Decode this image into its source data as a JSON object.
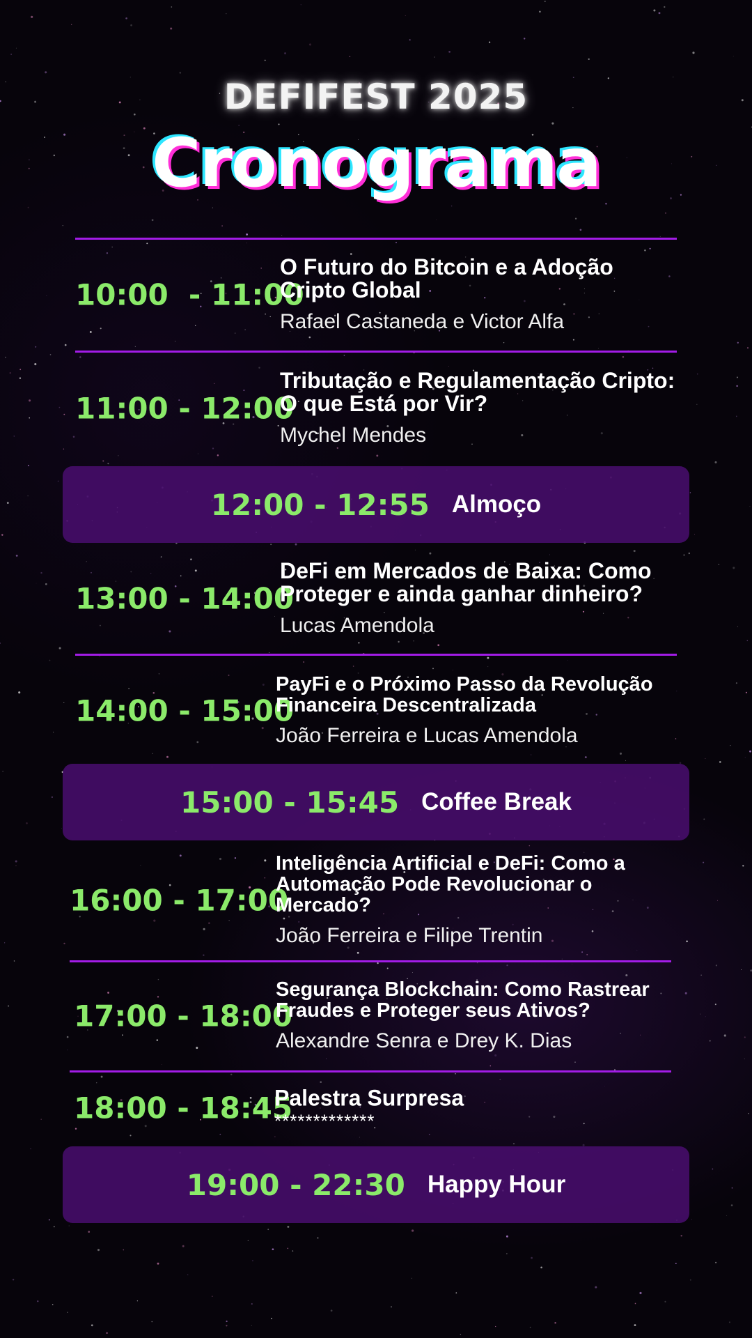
{
  "header": {
    "event_name": "DEFIFEST 2025",
    "title": "Cronograma"
  },
  "colors": {
    "background": "#07040b",
    "accent_purple": "#a21ce6",
    "break_bar": "#480e6c",
    "time_green": "#8bea6a",
    "text": "#ffffff"
  },
  "schedule": [
    {
      "time": "10:00  - 11:00",
      "title": "O Futuro do Bitcoin e a Adoção Cripto Global",
      "speaker": "Rafael Castaneda e Victor Alfa"
    },
    {
      "time": "11:00 - 12:00",
      "title": "Tributação e Regulamentação Cripto: O que Está por Vir?",
      "speaker": "Mychel Mendes"
    },
    {
      "time": "12:00 - 12:55",
      "label": "Almoço"
    },
    {
      "time": "13:00 - 14:00",
      "title": "DeFi em Mercados de Baixa: Como Proteger e ainda ganhar dinheiro?",
      "speaker": "Lucas Amendola"
    },
    {
      "time": "14:00 - 15:00",
      "title": "PayFi e o Próximo Passo da Revolução Financeira Descentralizada",
      "speaker": "João Ferreira e Lucas Amendola"
    },
    {
      "time": "15:00 - 15:45",
      "label": "Coffee Break"
    },
    {
      "time": "16:00 - 17:00",
      "title": "Inteligência Artificial e DeFi: Como a Automação Pode Revolucionar o Mercado?",
      "speaker": "João Ferreira e Filipe Trentin"
    },
    {
      "time": "17:00 - 18:00",
      "title": "Segurança Blockchain: Como Rastrear Fraudes e Proteger seus Ativos?",
      "speaker": "Alexandre Senra e Drey K. Dias"
    },
    {
      "time": "18:00 - 18:45",
      "title": "Palestra Surpresa",
      "speaker": "*************"
    },
    {
      "time": "19:00 - 22:30",
      "label": "Happy Hour"
    }
  ]
}
